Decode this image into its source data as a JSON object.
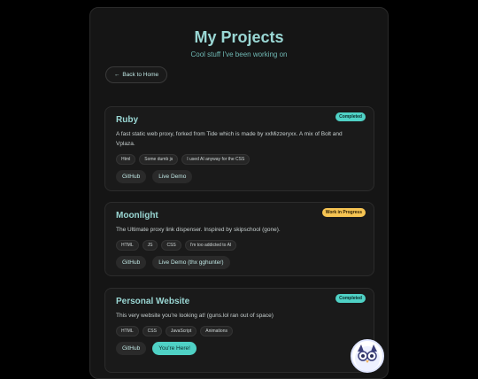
{
  "header": {
    "title": "My Projects",
    "subtitle": "Cool stuff I've been working on"
  },
  "nav": {
    "back_label": "Back to Home"
  },
  "projects": [
    {
      "title": "Ruby",
      "status": "Completed",
      "description": "A fast static web proxy, forked from Tide which is made by xxMizzeryxx. A mix of Bolt and Vplaza.",
      "tags": [
        "Html",
        "Some dumb js",
        "I used AI anyway for the CSS"
      ],
      "links": [
        "GitHub",
        "Live Demo"
      ]
    },
    {
      "title": "Moonlight",
      "status": "Work in Progress",
      "description": "The Ultimate proxy link dispenser. Inspired by skipschool (gone).",
      "tags": [
        "HTML",
        "JS",
        "CSS",
        "I'm too addicted to AI"
      ],
      "links": [
        "GitHub",
        "Live Demo (thx gghunter)"
      ]
    },
    {
      "title": "Personal Website",
      "status": "Completed",
      "description": "This very website you're looking at! (guns.lol ran out of space)",
      "tags": [
        "HTML",
        "CSS",
        "JavaScript",
        "Animations"
      ],
      "links": [
        "GitHub",
        "You're Here!"
      ]
    }
  ],
  "colors": {
    "accent": "#9ad7d4",
    "completed": "#4fd1c5",
    "wip": "#f6c453",
    "background": "#000000",
    "panel": "#151515"
  }
}
